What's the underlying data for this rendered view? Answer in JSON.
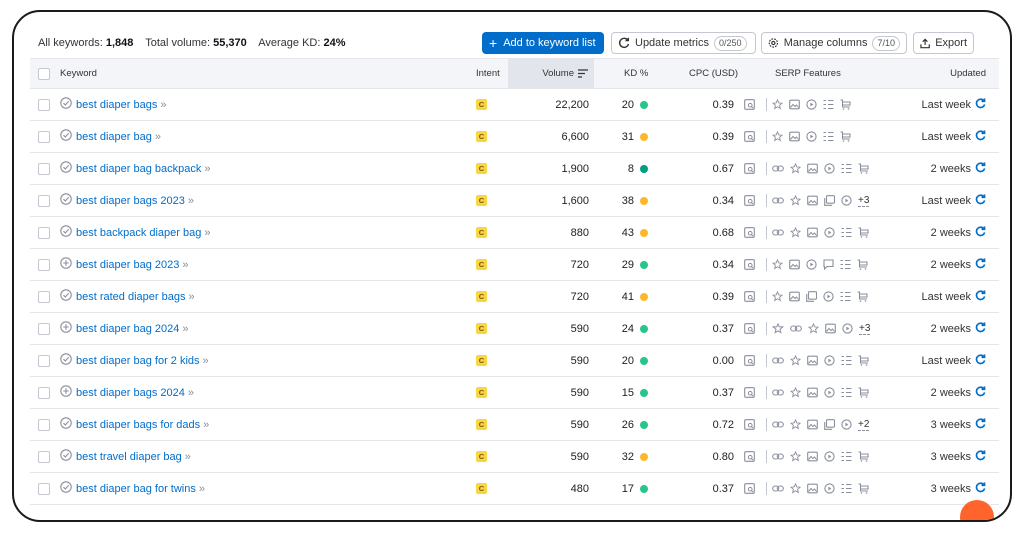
{
  "summary": {
    "keywords_label": "All keywords:",
    "keywords_value": "1,848",
    "volume_label": "Total volume:",
    "volume_value": "55,370",
    "kd_label": "Average KD:",
    "kd_value": "24%"
  },
  "toolbar": {
    "add_label": "Add to keyword list",
    "update_label": "Update metrics",
    "update_count": "0/250",
    "manage_label": "Manage columns",
    "manage_count": "7/10",
    "export_label": "Export"
  },
  "columns": {
    "keyword": "Keyword",
    "intent": "Intent",
    "volume": "Volume",
    "kd": "KD %",
    "cpc": "CPC (USD)",
    "serp": "SERP Features",
    "updated": "Updated"
  },
  "colors": {
    "accent": "#006dca",
    "kd_green": "#2bc48a",
    "kd_yellow": "#ffb62b",
    "kd_darkgreen": "#009f81",
    "intent_yellow": "#f7d545"
  },
  "rows": [
    {
      "keyword": "best diaper bags",
      "intent": "C",
      "volume": "22,200",
      "kd": "20",
      "kd_color": "#2bc48a",
      "cpc": "0.39",
      "serp": [
        "serp-image-icon",
        "sep",
        "star-icon",
        "image-icon",
        "video-icon",
        "list-icon",
        "cart-icon"
      ],
      "more": "",
      "updated": "Last week",
      "kw_icon": "check"
    },
    {
      "keyword": "best diaper bag",
      "intent": "C",
      "volume": "6,600",
      "kd": "31",
      "kd_color": "#ffb62b",
      "cpc": "0.39",
      "serp": [
        "serp-image-icon",
        "sep",
        "star-icon",
        "image-icon",
        "video-icon",
        "list-icon",
        "cart-icon"
      ],
      "more": "",
      "updated": "Last week",
      "kw_icon": "check"
    },
    {
      "keyword": "best diaper bag backpack",
      "intent": "C",
      "volume": "1,900",
      "kd": "8",
      "kd_color": "#009f81",
      "cpc": "0.67",
      "serp": [
        "serp-image-icon",
        "sep",
        "link-icon",
        "star-icon",
        "image-icon",
        "video-icon",
        "list-icon",
        "cart-icon"
      ],
      "more": "",
      "updated": "2 weeks",
      "kw_icon": "check"
    },
    {
      "keyword": "best diaper bags 2023",
      "intent": "C",
      "volume": "1,600",
      "kd": "38",
      "kd_color": "#ffb62b",
      "cpc": "0.34",
      "serp": [
        "serp-image-icon",
        "sep",
        "link-icon",
        "star-icon",
        "image-icon",
        "gallery-icon",
        "video-icon"
      ],
      "more": "+3",
      "updated": "Last week",
      "kw_icon": "check"
    },
    {
      "keyword": "best backpack diaper bag",
      "intent": "C",
      "volume": "880",
      "kd": "43",
      "kd_color": "#ffb62b",
      "cpc": "0.68",
      "serp": [
        "serp-image-icon",
        "sep",
        "link-icon",
        "star-icon",
        "image-icon",
        "video-icon",
        "list-icon",
        "cart-icon"
      ],
      "more": "",
      "updated": "2 weeks",
      "kw_icon": "check"
    },
    {
      "keyword": "best diaper bag 2023",
      "intent": "C",
      "volume": "720",
      "kd": "29",
      "kd_color": "#2bc48a",
      "cpc": "0.34",
      "serp": [
        "serp-image-icon",
        "sep",
        "star-icon",
        "image-icon",
        "video-icon",
        "comment-icon",
        "list-icon",
        "cart-icon"
      ],
      "more": "",
      "updated": "2 weeks",
      "kw_icon": "plus"
    },
    {
      "keyword": "best rated diaper bags",
      "intent": "C",
      "volume": "720",
      "kd": "41",
      "kd_color": "#ffb62b",
      "cpc": "0.39",
      "serp": [
        "serp-image-icon",
        "sep",
        "star-icon",
        "image-icon",
        "gallery-icon",
        "video-icon",
        "list-icon",
        "cart-icon"
      ],
      "more": "",
      "updated": "Last week",
      "kw_icon": "check"
    },
    {
      "keyword": "best diaper bag 2024",
      "intent": "C",
      "volume": "590",
      "kd": "24",
      "kd_color": "#2bc48a",
      "cpc": "0.37",
      "serp": [
        "serp-image-icon",
        "sep",
        "trophy-icon",
        "link-icon",
        "star-icon",
        "image-icon",
        "video-icon"
      ],
      "more": "+3",
      "updated": "2 weeks",
      "kw_icon": "plus"
    },
    {
      "keyword": "best diaper bag for 2 kids",
      "intent": "C",
      "volume": "590",
      "kd": "20",
      "kd_color": "#2bc48a",
      "cpc": "0.00",
      "serp": [
        "serp-image-icon",
        "sep",
        "link-icon",
        "star-icon",
        "image-icon",
        "video-icon",
        "list-icon",
        "cart-icon"
      ],
      "more": "",
      "updated": "Last week",
      "kw_icon": "check"
    },
    {
      "keyword": "best diaper bags 2024",
      "intent": "C",
      "volume": "590",
      "kd": "15",
      "kd_color": "#2bc48a",
      "cpc": "0.37",
      "serp": [
        "serp-image-icon",
        "sep",
        "link-icon",
        "star-icon",
        "image-icon",
        "video-icon",
        "list-icon",
        "cart-icon"
      ],
      "more": "",
      "updated": "2 weeks",
      "kw_icon": "plus"
    },
    {
      "keyword": "best diaper bags for dads",
      "intent": "C",
      "volume": "590",
      "kd": "26",
      "kd_color": "#2bc48a",
      "cpc": "0.72",
      "serp": [
        "serp-image-icon",
        "sep",
        "link-icon",
        "star-icon",
        "image-icon",
        "gallery-icon",
        "video-icon"
      ],
      "more": "+2",
      "updated": "3 weeks",
      "kw_icon": "check"
    },
    {
      "keyword": "best travel diaper bag",
      "intent": "C",
      "volume": "590",
      "kd": "32",
      "kd_color": "#ffb62b",
      "cpc": "0.80",
      "serp": [
        "serp-image-icon",
        "sep",
        "link-icon",
        "star-icon",
        "image-icon",
        "video-icon",
        "list-icon",
        "cart-icon"
      ],
      "more": "",
      "updated": "3 weeks",
      "kw_icon": "check"
    },
    {
      "keyword": "best diaper bag for twins",
      "intent": "C",
      "volume": "480",
      "kd": "17",
      "kd_color": "#2bc48a",
      "cpc": "0.37",
      "serp": [
        "serp-image-icon",
        "sep",
        "link-icon",
        "star-icon",
        "image-icon",
        "video-icon",
        "list-icon",
        "cart-icon"
      ],
      "more": "",
      "updated": "3 weeks",
      "kw_icon": "check"
    }
  ]
}
